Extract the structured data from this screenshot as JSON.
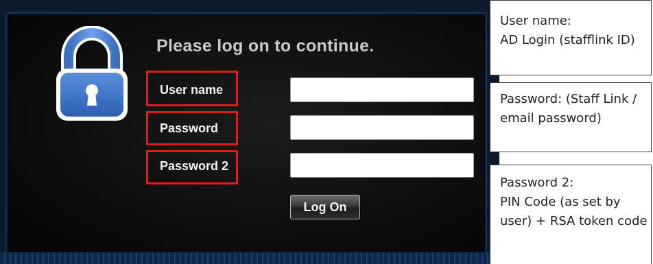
{
  "login": {
    "heading": "Please log on to continue.",
    "username_label": "User name",
    "password_label": "Password",
    "password2_label": "Password 2",
    "username_value": "",
    "password_value": "",
    "password2_value": "",
    "logon_button": "Log On"
  },
  "annotations": {
    "username": [
      "User name:",
      "AD Login (stafflink ID)"
    ],
    "password": [
      "Password: (Staff Link /",
      "email password)"
    ],
    "password2": [
      "Password 2:",
      "PIN Code (as set by",
      "user) + RSA token code"
    ]
  },
  "colors": {
    "highlight": "#e01b1b",
    "panel_background": "#0a0a0a",
    "lock_blue": "#3f78c9"
  },
  "icons": {
    "lock": "padlock-icon"
  }
}
